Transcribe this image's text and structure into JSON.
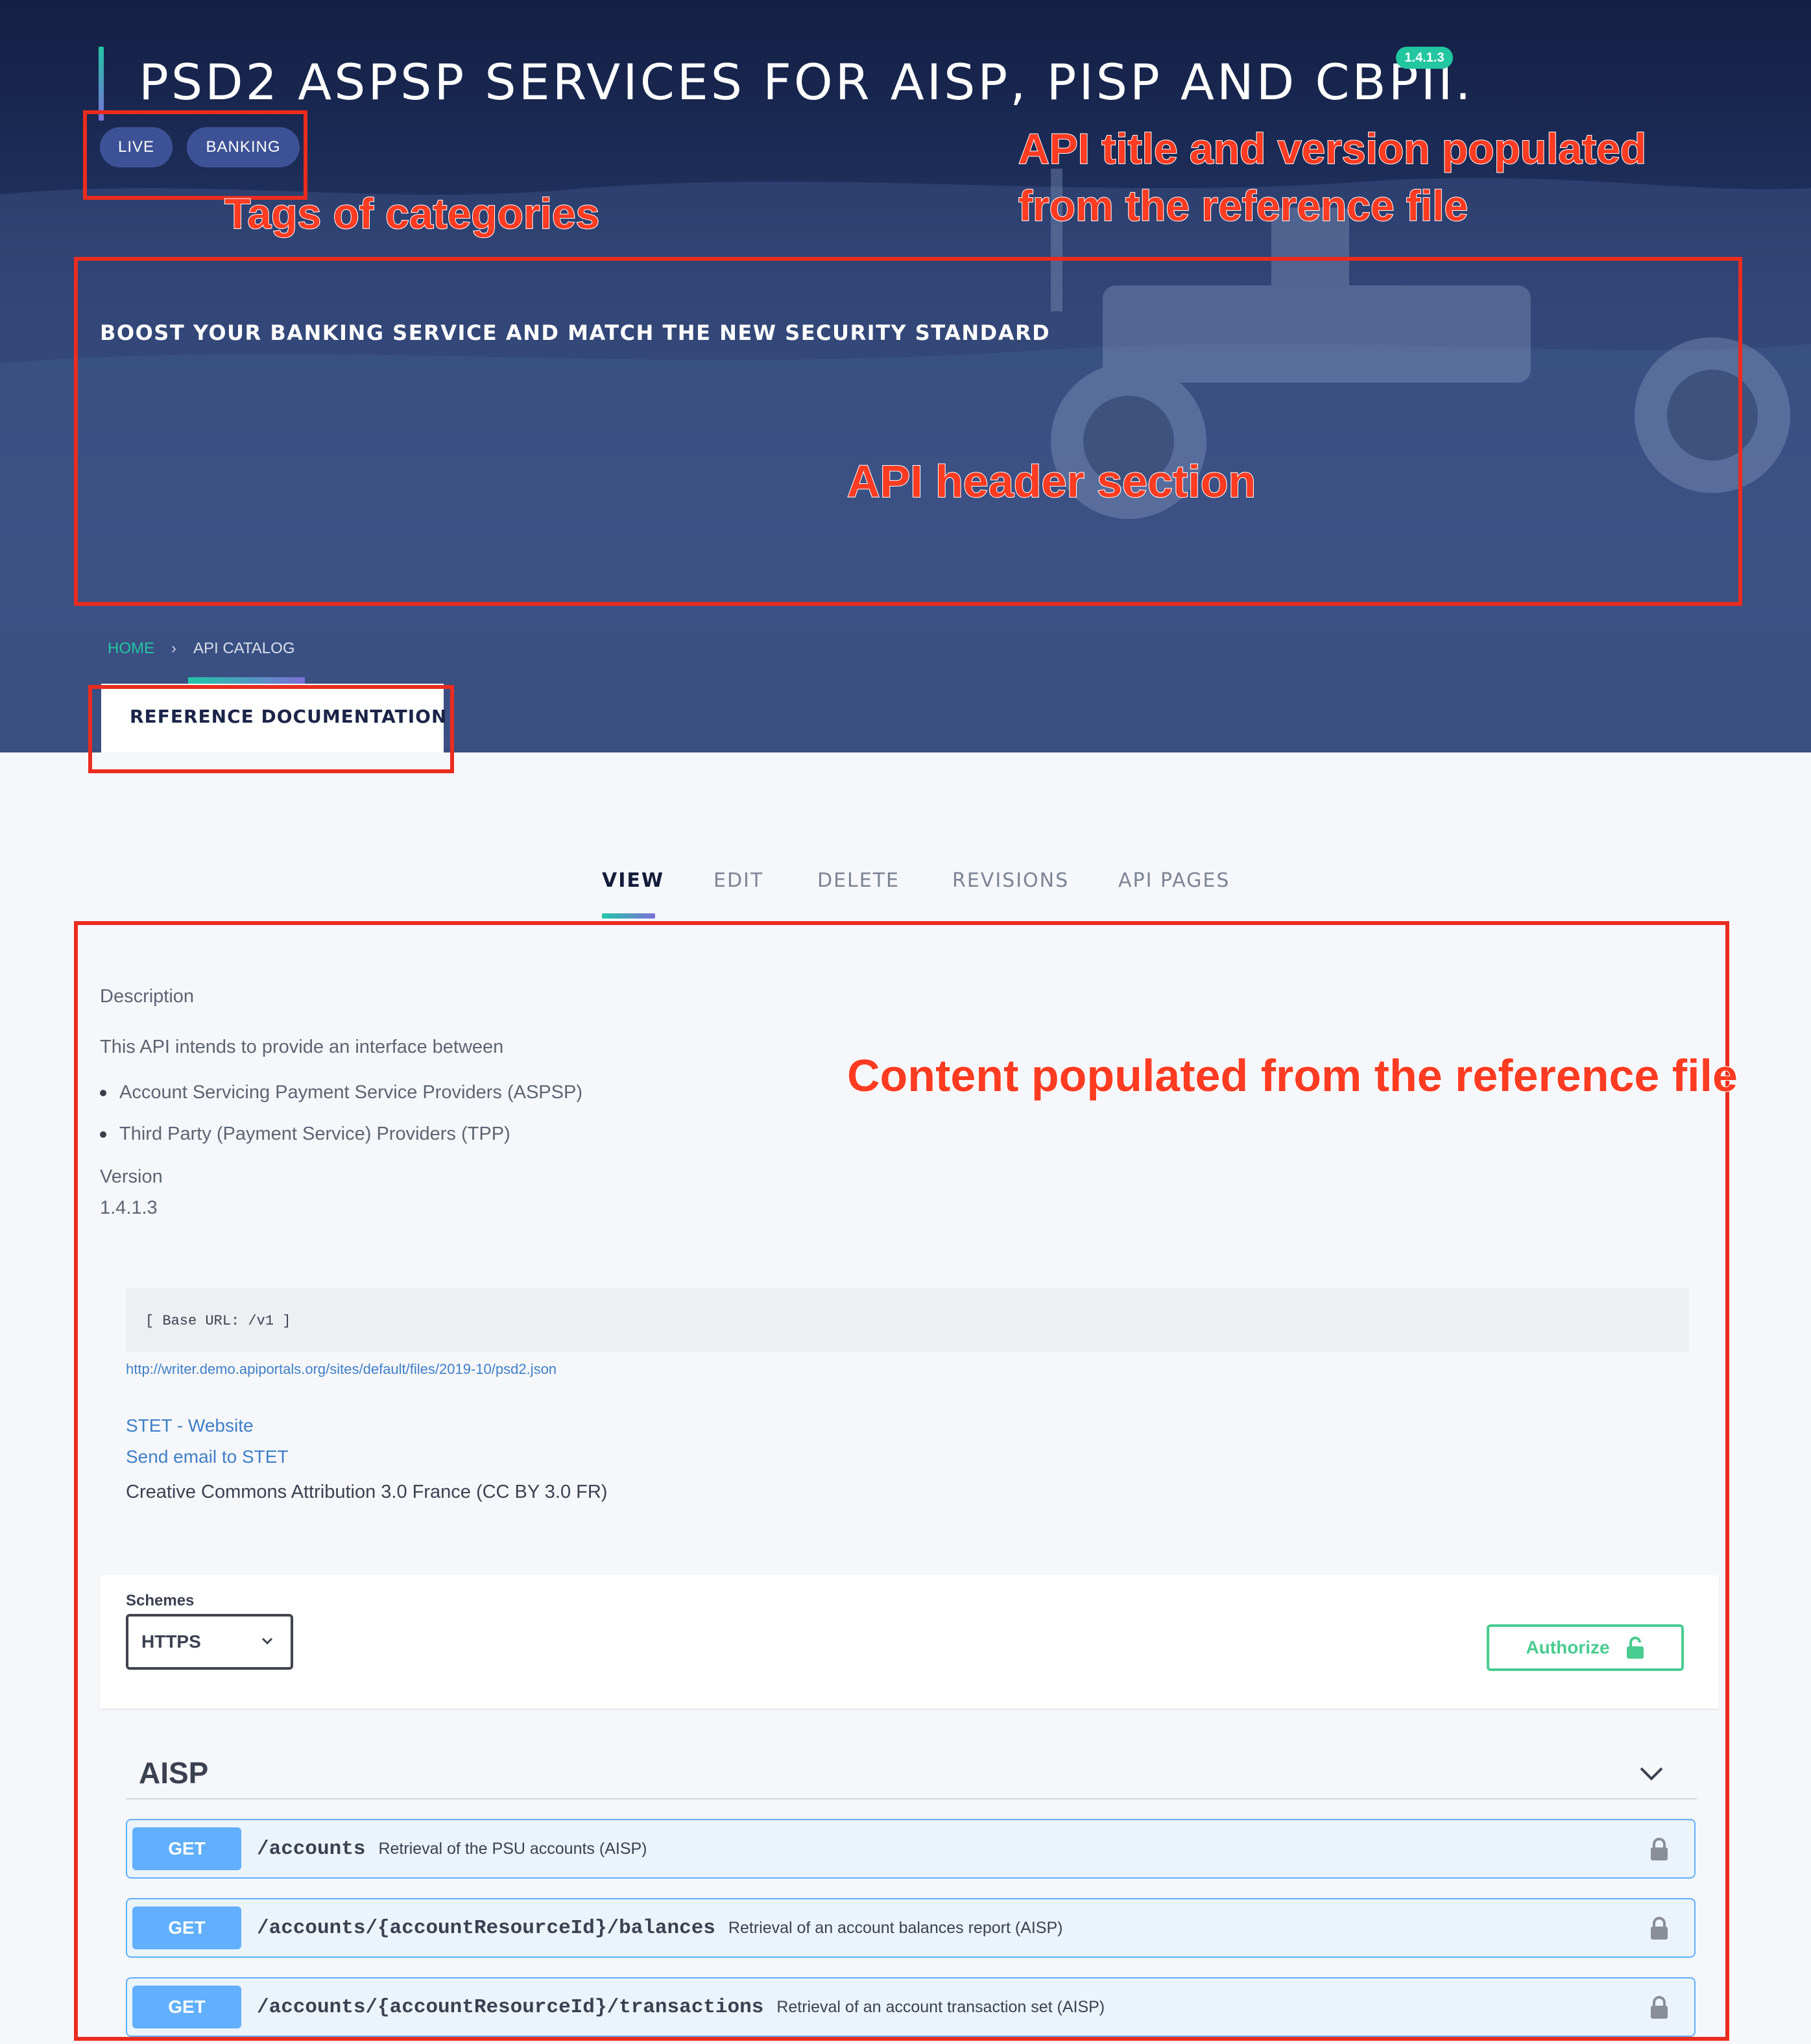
{
  "header": {
    "title": "PSD2 ASPSP SERVICES FOR AISP, PISP AND CBPII.",
    "version_badge": "1.4.1.3",
    "tags": [
      "LIVE",
      "BANKING"
    ],
    "subtitle": "BOOST YOUR BANKING SERVICE AND MATCH THE NEW SECURITY STANDARD"
  },
  "breadcrumb": {
    "home": "HOME",
    "separator": "›",
    "current": "API CATALOG"
  },
  "reference_tab": {
    "label": "REFERENCE DOCUMENTATION"
  },
  "tabs": [
    {
      "label": "VIEW",
      "active": true
    },
    {
      "label": "EDIT",
      "active": false
    },
    {
      "label": "DELETE",
      "active": false
    },
    {
      "label": "REVISIONS",
      "active": false
    },
    {
      "label": "API PAGES",
      "active": false
    }
  ],
  "annotations": {
    "tags": "Tags of categories",
    "title_version_line1": "API title and version populated",
    "title_version_line2": "from the reference file",
    "header_section": "API header section",
    "content": "Content populated from the reference file"
  },
  "content": {
    "description_label": "Description",
    "description_text": "This API intends to provide an interface between",
    "bullets": [
      "Account Servicing Payment Service Providers (ASPSP)",
      "Third Party (Payment Service) Providers (TPP)"
    ],
    "version_label": "Version",
    "version_value": "1.4.1.3",
    "base_url": "[ Base URL: /v1 ]",
    "spec_link": "http://writer.demo.apiportals.org/sites/default/files/2019-10/psd2.json",
    "contact_website": "STET - Website",
    "contact_email": "Send email to STET",
    "license": "Creative Commons Attribution 3.0 France (CC BY 3.0 FR)"
  },
  "schemes": {
    "label": "Schemes",
    "selected": "HTTPS",
    "authorize_label": "Authorize"
  },
  "operations_group": {
    "title": "AISP",
    "operations": [
      {
        "method": "GET",
        "path": "/accounts",
        "summary": "Retrieval of the PSU accounts (AISP)"
      },
      {
        "method": "GET",
        "path": "/accounts/{accountResourceId}/balances",
        "summary": "Retrieval of an account balances report (AISP)"
      },
      {
        "method": "GET",
        "path": "/accounts/{accountResourceId}/transactions",
        "summary": "Retrieval of an account transaction set (AISP)"
      }
    ]
  },
  "colors": {
    "hero_dark": "#131f44",
    "accent_teal": "#22c6a0",
    "accent_purple": "#7b6fd6",
    "annotation_red": "#ea2c1f",
    "get_blue": "#61affe",
    "authorize_green": "#49cc90"
  },
  "icons": {
    "breadcrumb_separator": "chevron-right-icon",
    "schemes_dropdown": "chevron-down-icon",
    "authorize": "unlock-icon",
    "operation_lock": "lock-icon",
    "collapse": "chevron-down-icon"
  }
}
